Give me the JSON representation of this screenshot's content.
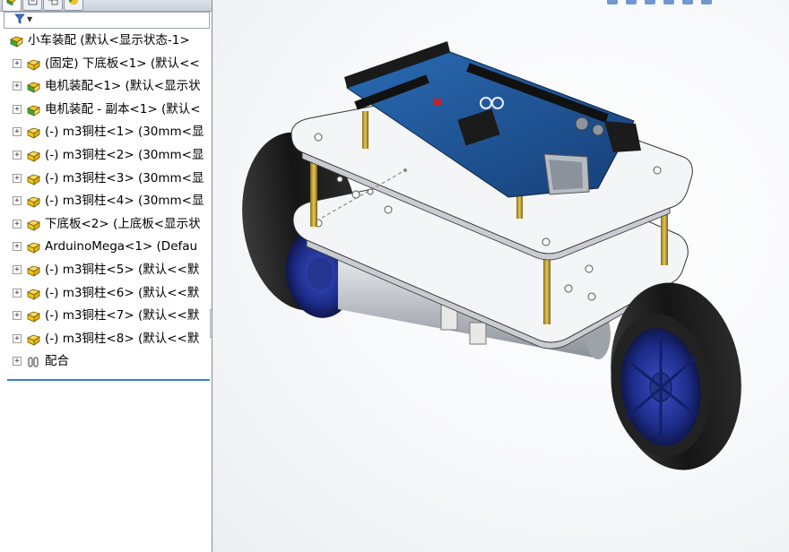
{
  "tabs": [
    {
      "name": "feature-manager-tab",
      "icon": "feature-manager-icon",
      "active": true
    },
    {
      "name": "property-manager-tab",
      "icon": "property-manager-icon",
      "active": false
    },
    {
      "name": "configuration-manager-tab",
      "icon": "configuration-manager-icon",
      "active": false
    },
    {
      "name": "display-manager-tab",
      "icon": "appearance-icon",
      "active": false
    }
  ],
  "filter": {
    "icon": "filter-icon"
  },
  "tree": {
    "root": {
      "label": "小车装配  (默认<显示状态-1>",
      "icon": "assembly-icon"
    },
    "items": [
      {
        "label": "(固定) 下底板<1> (默认<<",
        "icon": "part-icon"
      },
      {
        "label": "电机装配<1> (默认<显示状",
        "icon": "subassembly-icon"
      },
      {
        "label": "电机装配 - 副本<1> (默认<",
        "icon": "subassembly-icon"
      },
      {
        "label": "(-) m3铜柱<1> (30mm<显",
        "icon": "part-icon"
      },
      {
        "label": "(-) m3铜柱<2> (30mm<显",
        "icon": "part-icon"
      },
      {
        "label": "(-) m3铜柱<3> (30mm<显",
        "icon": "part-icon"
      },
      {
        "label": "(-) m3铜柱<4> (30mm<显",
        "icon": "part-icon"
      },
      {
        "label": "下底板<2> (上底板<显示状",
        "icon": "part-icon"
      },
      {
        "label": "ArduinoMega<1> (Defau",
        "icon": "part-icon"
      },
      {
        "label": "(-) m3铜柱<5> (默认<<默",
        "icon": "part-icon"
      },
      {
        "label": "(-) m3铜柱<6> (默认<<默",
        "icon": "part-icon"
      },
      {
        "label": "(-) m3铜柱<7> (默认<<默",
        "icon": "part-icon"
      },
      {
        "label": "(-) m3铜柱<8> (默认<<默",
        "icon": "part-icon"
      }
    ],
    "mates": {
      "label": "配合",
      "icon": "mates-icon"
    }
  },
  "viewport": {
    "model": "two-wheel-robot-car-assembly",
    "colors": {
      "plate": "#f4f5f7",
      "board": "#1c4f8f",
      "header": "#1a1a1a",
      "standoff": "#c9a53a",
      "tire": "#1a1a1a",
      "rim": "#1d2d8a",
      "motor": "#b8bcc2"
    }
  }
}
